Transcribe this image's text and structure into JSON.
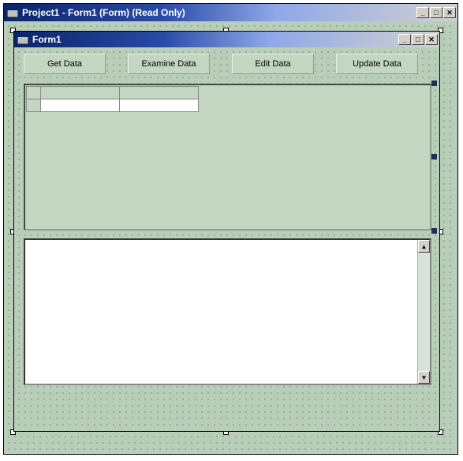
{
  "outerWindow": {
    "title": "Project1 - Form1 (Form)  (Read Only)"
  },
  "innerForm": {
    "title": "Form1"
  },
  "buttons": {
    "btn1": "Get Data",
    "btn2": "Examine Data",
    "btn3": "Edit Data",
    "btn4": "Update Data"
  },
  "winControls": {
    "min": "_",
    "max": "□",
    "close": "✕"
  },
  "scroll": {
    "up": "▲",
    "down": "▼"
  }
}
